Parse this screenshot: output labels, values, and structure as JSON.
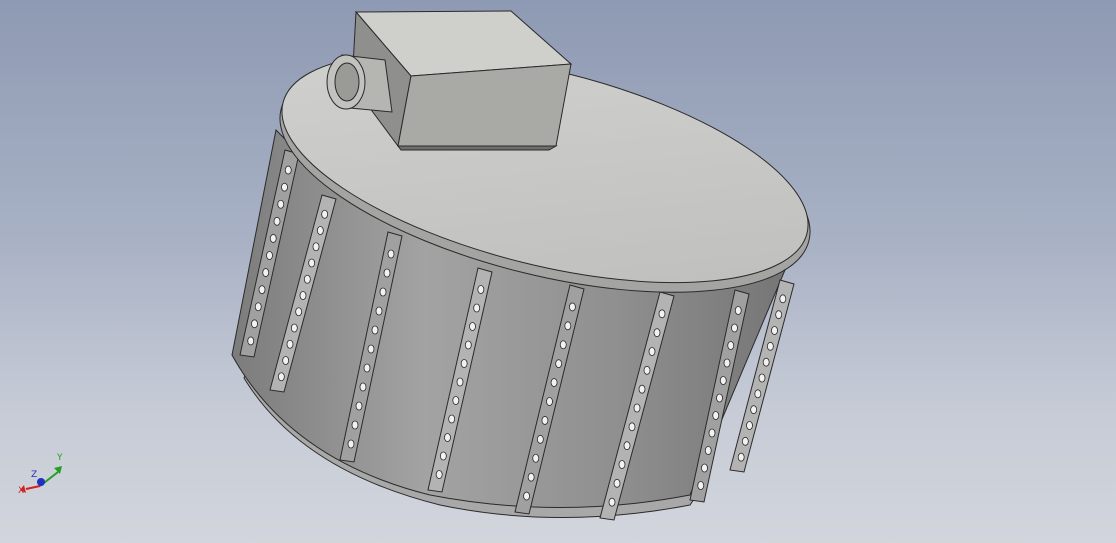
{
  "viewport": {
    "background_top": "#8e9ab3",
    "background_bottom": "#d2d5dc"
  },
  "model": {
    "body_color": "#9c9c9c",
    "lid_color": "#c4c4c2",
    "edge_color": "#2a2a2a",
    "box_color": "#c0c0bd"
  },
  "view_cube_triad": {
    "x_label": "X",
    "y_label": "Y",
    "z_label": "Z",
    "x_color": "#d02020",
    "y_color": "#22a022",
    "z_color": "#2030c0"
  }
}
